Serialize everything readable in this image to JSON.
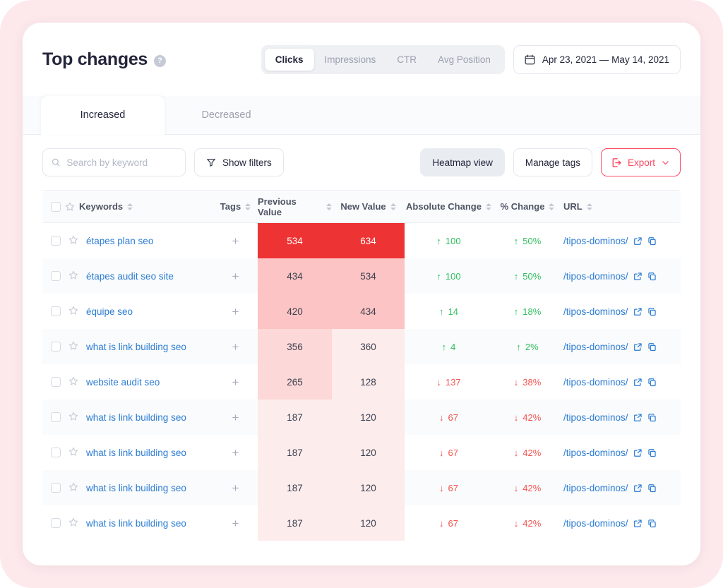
{
  "header": {
    "title": "Top changes",
    "help_icon": "question-mark-icon",
    "metrics": [
      {
        "label": "Clicks",
        "active": true
      },
      {
        "label": "Impressions",
        "active": false
      },
      {
        "label": "CTR",
        "active": false
      },
      {
        "label": "Avg Position",
        "active": false
      }
    ],
    "date_range": "Apr 23, 2021 — May 14, 2021",
    "calendar_icon": "calendar-icon"
  },
  "tabs": [
    {
      "label": "Increased",
      "active": true
    },
    {
      "label": "Decreased",
      "active": false
    }
  ],
  "toolbar": {
    "search_placeholder": "Search by keyword",
    "search_value": "",
    "search_icon": "search-icon",
    "show_filters_label": "Show filters",
    "filter_icon": "funnel-icon",
    "heatmap_label": "Heatmap view",
    "manage_tags_label": "Manage tags",
    "export_label": "Export",
    "export_icon": "export-icon",
    "chevron_icon": "chevron-down-icon"
  },
  "table": {
    "columns": [
      {
        "key": "keywords",
        "label": "Keywords",
        "sortable": true
      },
      {
        "key": "tags",
        "label": "Tags",
        "sortable": true
      },
      {
        "key": "previous_value",
        "label": "Previous Value",
        "sortable": true
      },
      {
        "key": "new_value",
        "label": "New Value",
        "sortable": true
      },
      {
        "key": "absolute_change",
        "label": "Absolute Change",
        "sortable": true
      },
      {
        "key": "percent_change",
        "label": "% Change",
        "sortable": true
      },
      {
        "key": "url",
        "label": "URL",
        "sortable": true
      }
    ],
    "rows": [
      {
        "keyword": "étapes plan seo",
        "tag_add": "+",
        "previous_value": "534",
        "new_value": "634",
        "previous_bg": "#ee3334",
        "previous_fg": "#ffffff",
        "new_bg": "#ee3334",
        "new_fg": "#ffffff",
        "absolute_change": "100",
        "absolute_dir": "up",
        "percent_change": "50%",
        "percent_dir": "up",
        "url": "/tipos-dominos/"
      },
      {
        "keyword": "étapes audit seo site",
        "tag_add": "+",
        "previous_value": "434",
        "new_value": "534",
        "previous_bg": "#fcc4c4",
        "previous_fg": "#3b4050",
        "new_bg": "#fcc4c4",
        "new_fg": "#3b4050",
        "absolute_change": "100",
        "absolute_dir": "up",
        "percent_change": "50%",
        "percent_dir": "up",
        "url": "/tipos-dominos/"
      },
      {
        "keyword": "équipe seo",
        "tag_add": "+",
        "previous_value": "420",
        "new_value": "434",
        "previous_bg": "#fcc4c4",
        "previous_fg": "#3b4050",
        "new_bg": "#fcc4c4",
        "new_fg": "#3b4050",
        "absolute_change": "14",
        "absolute_dir": "up",
        "percent_change": "18%",
        "percent_dir": "up",
        "url": "/tipos-dominos/"
      },
      {
        "keyword": "what is link building seo",
        "tag_add": "+",
        "previous_value": "356",
        "new_value": "360",
        "previous_bg": "#fdd8d8",
        "previous_fg": "#3b4050",
        "new_bg": "#fdecec",
        "new_fg": "#3b4050",
        "absolute_change": "4",
        "absolute_dir": "up",
        "percent_change": "2%",
        "percent_dir": "up",
        "url": "/tipos-dominos/"
      },
      {
        "keyword": "website audit seo",
        "tag_add": "+",
        "previous_value": "265",
        "new_value": "128",
        "previous_bg": "#fdd8d8",
        "previous_fg": "#3b4050",
        "new_bg": "#fdecec",
        "new_fg": "#3b4050",
        "absolute_change": "137",
        "absolute_dir": "down",
        "percent_change": "38%",
        "percent_dir": "down",
        "url": "/tipos-dominos/"
      },
      {
        "keyword": "what is link building seo",
        "tag_add": "+",
        "previous_value": "187",
        "new_value": "120",
        "previous_bg": "#fdecec",
        "previous_fg": "#3b4050",
        "new_bg": "#fdecec",
        "new_fg": "#3b4050",
        "absolute_change": "67",
        "absolute_dir": "down",
        "percent_change": "42%",
        "percent_dir": "down",
        "url": "/tipos-dominos/"
      },
      {
        "keyword": "what is link building seo",
        "tag_add": "+",
        "previous_value": "187",
        "new_value": "120",
        "previous_bg": "#fdecec",
        "previous_fg": "#3b4050",
        "new_bg": "#fdecec",
        "new_fg": "#3b4050",
        "absolute_change": "67",
        "absolute_dir": "down",
        "percent_change": "42%",
        "percent_dir": "down",
        "url": "/tipos-dominos/"
      },
      {
        "keyword": "what is link building seo",
        "tag_add": "+",
        "previous_value": "187",
        "new_value": "120",
        "previous_bg": "#fdecec",
        "previous_fg": "#3b4050",
        "new_bg": "#fdecec",
        "new_fg": "#3b4050",
        "absolute_change": "67",
        "absolute_dir": "down",
        "percent_change": "42%",
        "percent_dir": "down",
        "url": "/tipos-dominos/"
      },
      {
        "keyword": "what is link building seo",
        "tag_add": "+",
        "previous_value": "187",
        "new_value": "120",
        "previous_bg": "#fdecec",
        "previous_fg": "#3b4050",
        "new_bg": "#fdecec",
        "new_fg": "#3b4050",
        "absolute_change": "67",
        "absolute_dir": "down",
        "percent_change": "42%",
        "percent_dir": "down",
        "url": "/tipos-dominos/"
      }
    ]
  },
  "colors": {
    "accent_red": "#fb4a64",
    "link_blue": "#2b7cd3",
    "up_green": "#2fbd5f",
    "down_red": "#f0544f",
    "page_bg": "#fde9ec",
    "heat_max": "#ee3334"
  },
  "icons": {
    "up_arrow": "↑",
    "down_arrow": "↓",
    "star": "star-outline-icon",
    "checkbox": "checkbox-icon",
    "external_link": "external-link-icon",
    "copy": "copy-icon"
  }
}
